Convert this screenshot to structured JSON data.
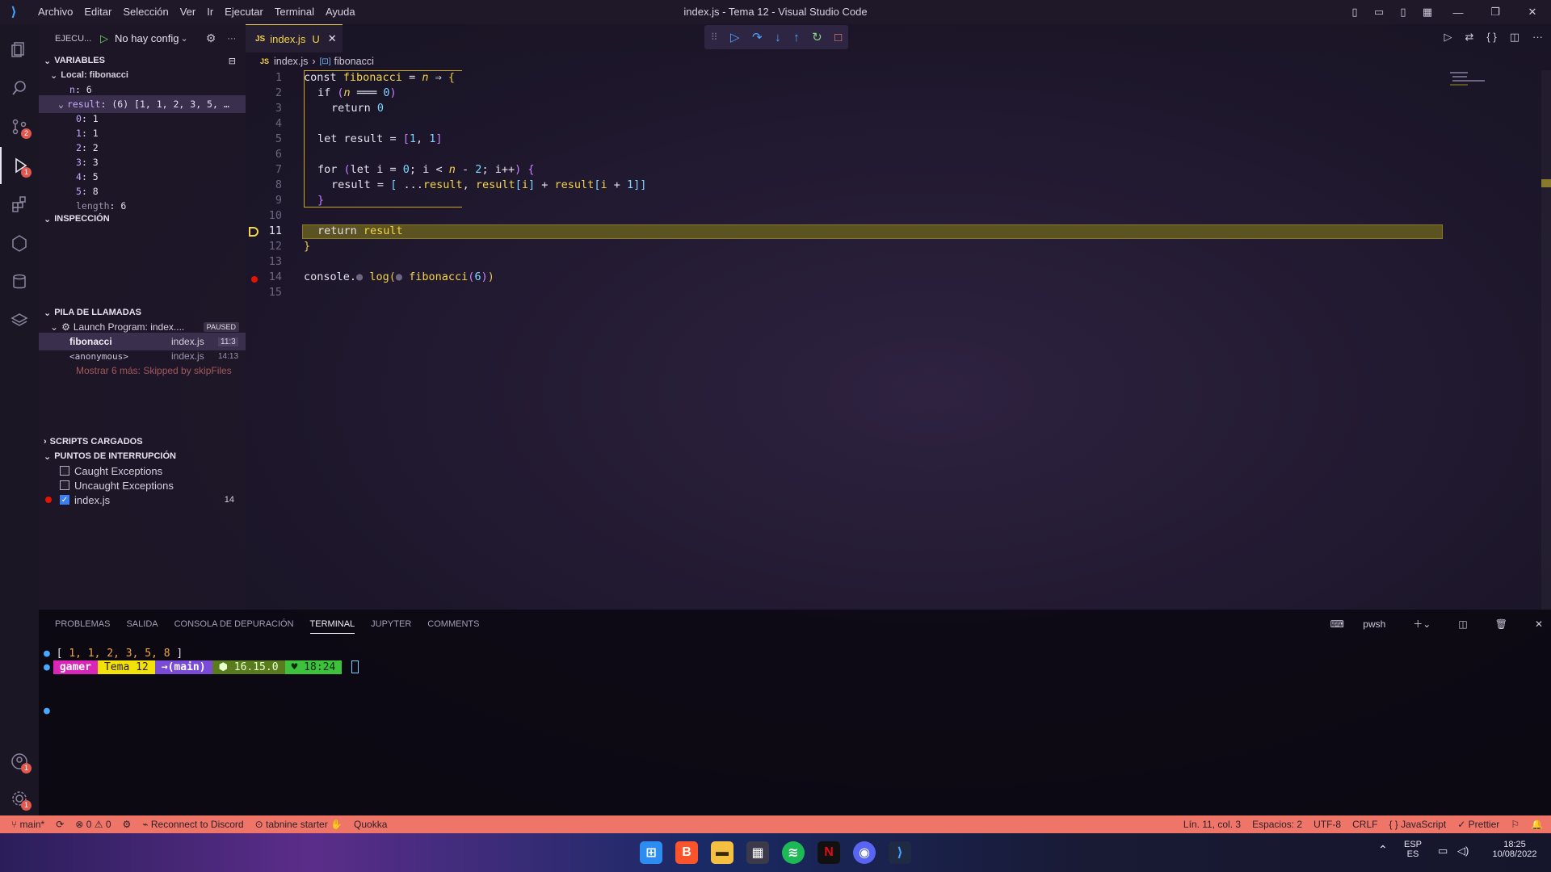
{
  "window": {
    "menu": [
      "Archivo",
      "Editar",
      "Selección",
      "Ver",
      "Ir",
      "Ejecutar",
      "Terminal",
      "Ayuda"
    ],
    "title": "index.js - Tema 12 - Visual Studio Code"
  },
  "activity": {
    "scm_badge": "2",
    "debug_badge": "1",
    "accounts_badge": "1",
    "settings_badge": "1"
  },
  "sidebar": {
    "run_label": "EJECU...",
    "config": "No hay config",
    "variables_title": "VARIABLES",
    "local_scope": "Local: fibonacci",
    "n_name": "n",
    "n_value": "6",
    "result_name": "result",
    "result_value": "(6) [1, 1, 2, 3, 5, …",
    "result_items": [
      {
        "k": "0",
        "v": "1"
      },
      {
        "k": "1",
        "v": "1"
      },
      {
        "k": "2",
        "v": "2"
      },
      {
        "k": "3",
        "v": "3"
      },
      {
        "k": "4",
        "v": "5"
      },
      {
        "k": "5",
        "v": "8"
      }
    ],
    "length_name": "length",
    "length_value": "6",
    "watch_title": "INSPECCIÓN",
    "callstack_title": "PILA DE LLAMADAS",
    "launch_program": "Launch Program: index....",
    "paused": "PAUSED",
    "frames": [
      {
        "name": "fibonacci",
        "file": "index.js",
        "pos": "11:3"
      },
      {
        "name": "<anonymous>",
        "file": "index.js",
        "pos": "14:13"
      }
    ],
    "show_more": "Mostrar 6 más: Skipped by skipFiles",
    "loaded_scripts": "SCRIPTS CARGADOS",
    "breakpoints_title": "PUNTOS DE INTERRUPCIÓN",
    "caught": "Caught Exceptions",
    "uncaught": "Uncaught Exceptions",
    "bp_file": "index.js",
    "bp_line": "14"
  },
  "editor": {
    "tab_name": "index.js",
    "tab_status": "U",
    "breadcrumb_file": "index.js",
    "breadcrumb_symbol": "fibonacci",
    "line_numbers": [
      "1",
      "2",
      "3",
      "4",
      "5",
      "6",
      "7",
      "8",
      "9",
      "10",
      "11",
      "12",
      "13",
      "14",
      "15"
    ]
  },
  "panel": {
    "tabs": [
      "PROBLEMAS",
      "SALIDA",
      "CONSOLA DE DEPURACIÓN",
      "TERMINAL",
      "JUPYTER",
      "COMMENTS"
    ],
    "shell": "pwsh",
    "out_open": "[",
    "out_values": [
      "1,",
      "1,",
      "2,",
      "3,",
      "5,",
      "8"
    ],
    "out_close": "]",
    "prompt_user": "gamer",
    "prompt_dir": "Tema 12",
    "prompt_branch": "→(main)",
    "prompt_node": "⬢ 16.15.0",
    "prompt_time": "♥ 18:24"
  },
  "status": {
    "branch": "main*",
    "errors": "0",
    "warnings": "0",
    "discord": "Reconnect to Discord",
    "tabnine": "tabnine starter",
    "quokka": "Quokka",
    "position": "Lín. 11, col. 3",
    "spaces": "Espacios: 2",
    "encoding": "UTF-8",
    "eol": "CRLF",
    "language": "JavaScript",
    "prettier": "Prettier"
  },
  "taskbar": {
    "lang": "ESP",
    "region": "ES",
    "time": "18:25",
    "date": "10/08/2022"
  },
  "colors": {
    "accent": "#f07569",
    "current_line": "#5c5323",
    "debug_blue": "#4da3ff"
  }
}
